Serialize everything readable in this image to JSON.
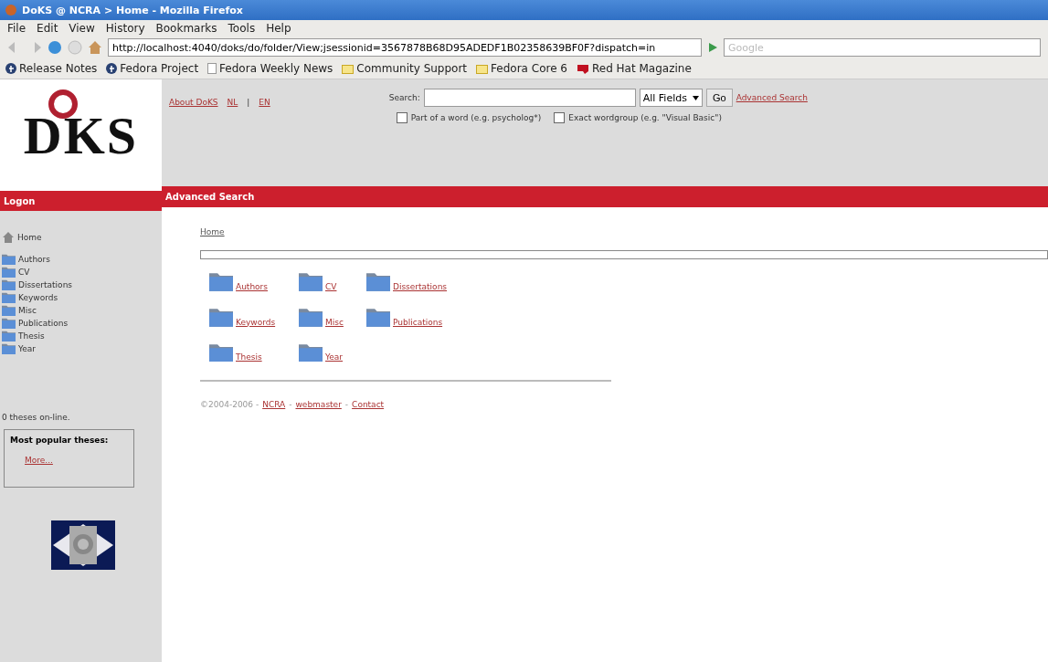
{
  "window": {
    "title": "DoKS @ NCRA > Home - Mozilla Firefox"
  },
  "menu": [
    "File",
    "Edit",
    "View",
    "History",
    "Bookmarks",
    "Tools",
    "Help"
  ],
  "address": {
    "url": "http://localhost:4040/doks/do/folder/View;jsessionid=3567878B68D95ADEDF1B02358639BF0F?dispatch=in",
    "search_placeholder": "Google"
  },
  "bookmarks": [
    {
      "label": "Release Notes",
      "kind": "fedora"
    },
    {
      "label": "Fedora Project",
      "kind": "fedora"
    },
    {
      "label": "Fedora Weekly News",
      "kind": "page"
    },
    {
      "label": "Community Support",
      "kind": "folder"
    },
    {
      "label": "Fedora Core 6",
      "kind": "folder"
    },
    {
      "label": "Red Hat Magazine",
      "kind": "redhat"
    }
  ],
  "logo": {
    "text": "DKS"
  },
  "header": {
    "about": "About DoKS",
    "languages": [
      "NL",
      "EN"
    ],
    "separator": "|",
    "search_label": "Search:",
    "field_select": "All Fields",
    "go": "Go",
    "advanced_link": "Advanced Search",
    "options": [
      {
        "label": "Part of a word (e.g. psycholog*)",
        "checked": false
      },
      {
        "label": "Exact wordgroup (e.g. \"Visual Basic\")",
        "checked": false
      }
    ]
  },
  "red_bar": "Advanced Search",
  "logon": "Logon",
  "sidebar": {
    "home": "Home",
    "items": [
      "Authors",
      "CV",
      "Dissertations",
      "Keywords",
      "Misc",
      "Publications",
      "Thesis",
      "Year"
    ],
    "online": "0 theses on-line.",
    "popular_title": "Most popular theses:",
    "more": "More..."
  },
  "breadcrumb": "Home",
  "folders": [
    [
      "Authors",
      "CV",
      "Dissertations"
    ],
    [
      "Keywords",
      "Misc",
      "Publications"
    ],
    [
      "Thesis",
      "Year"
    ]
  ],
  "footer": {
    "copyright": "©2004-2006 -",
    "links": [
      "NCRA",
      "webmaster",
      "Contact"
    ],
    "separator": "-"
  }
}
